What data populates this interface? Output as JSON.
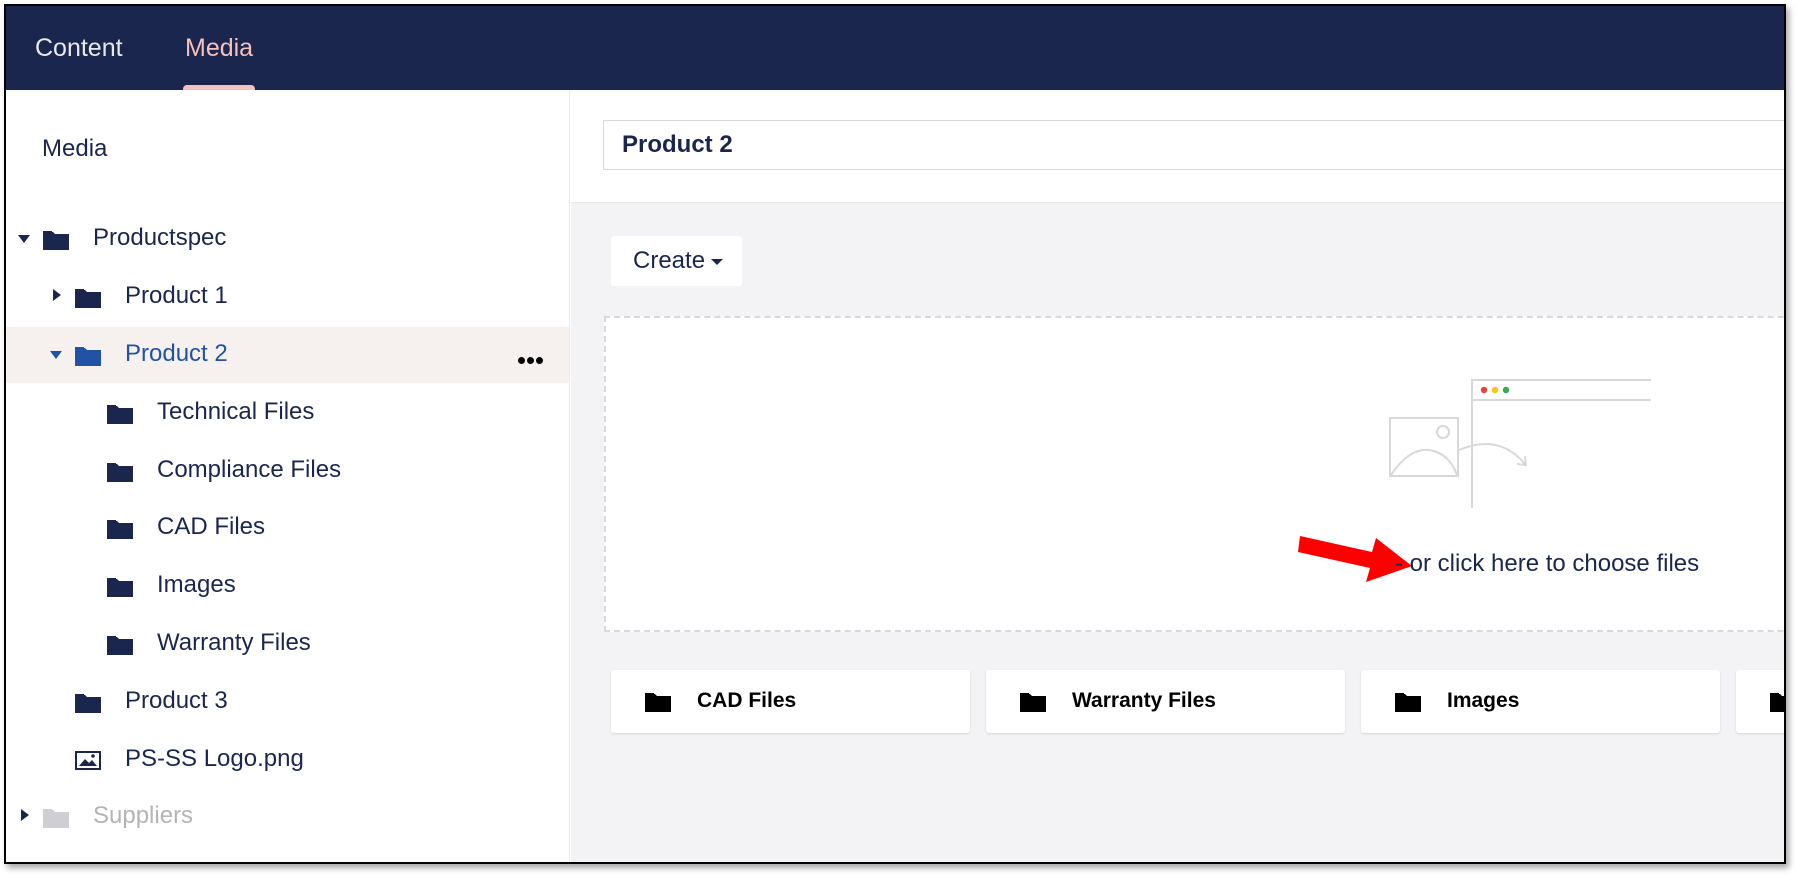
{
  "topbar": {
    "tabs": [
      {
        "label": "Content",
        "active": false
      },
      {
        "label": "Media",
        "active": true
      }
    ],
    "bg_color": "#1b264f",
    "active_color": "#f5c1bc"
  },
  "sidebar": {
    "title": "Media",
    "items": [
      {
        "label": "Productspec",
        "icon": "folder-icon",
        "expanded": true
      },
      {
        "label": "Product 1",
        "icon": "folder-icon",
        "expanded": false
      },
      {
        "label": "Product 2",
        "icon": "folder-icon",
        "expanded": true,
        "selected": true
      },
      {
        "label": "Technical Files",
        "icon": "folder-icon"
      },
      {
        "label": "Compliance Files",
        "icon": "folder-icon"
      },
      {
        "label": "CAD Files",
        "icon": "folder-icon"
      },
      {
        "label": "Images",
        "icon": "folder-icon"
      },
      {
        "label": "Warranty Files",
        "icon": "folder-icon"
      },
      {
        "label": "Product 3",
        "icon": "folder-icon"
      },
      {
        "label": "PS-SS Logo.png",
        "icon": "image-icon"
      },
      {
        "label": "Suppliers",
        "icon": "folder-icon",
        "expanded": false,
        "muted": true
      }
    ],
    "selected_color": "#2152a3"
  },
  "main": {
    "name_value": "Product 2",
    "create_label": "Create",
    "dropzone_text": "- or click here to choose files",
    "folder_cards": [
      {
        "label": "CAD Files",
        "icon": "folder-icon"
      },
      {
        "label": "Warranty Files",
        "icon": "folder-icon"
      },
      {
        "label": "Images",
        "icon": "folder-icon"
      },
      {
        "label": "",
        "icon": "folder-icon"
      }
    ]
  },
  "annotation": {
    "arrow_color": "#ff0000"
  }
}
